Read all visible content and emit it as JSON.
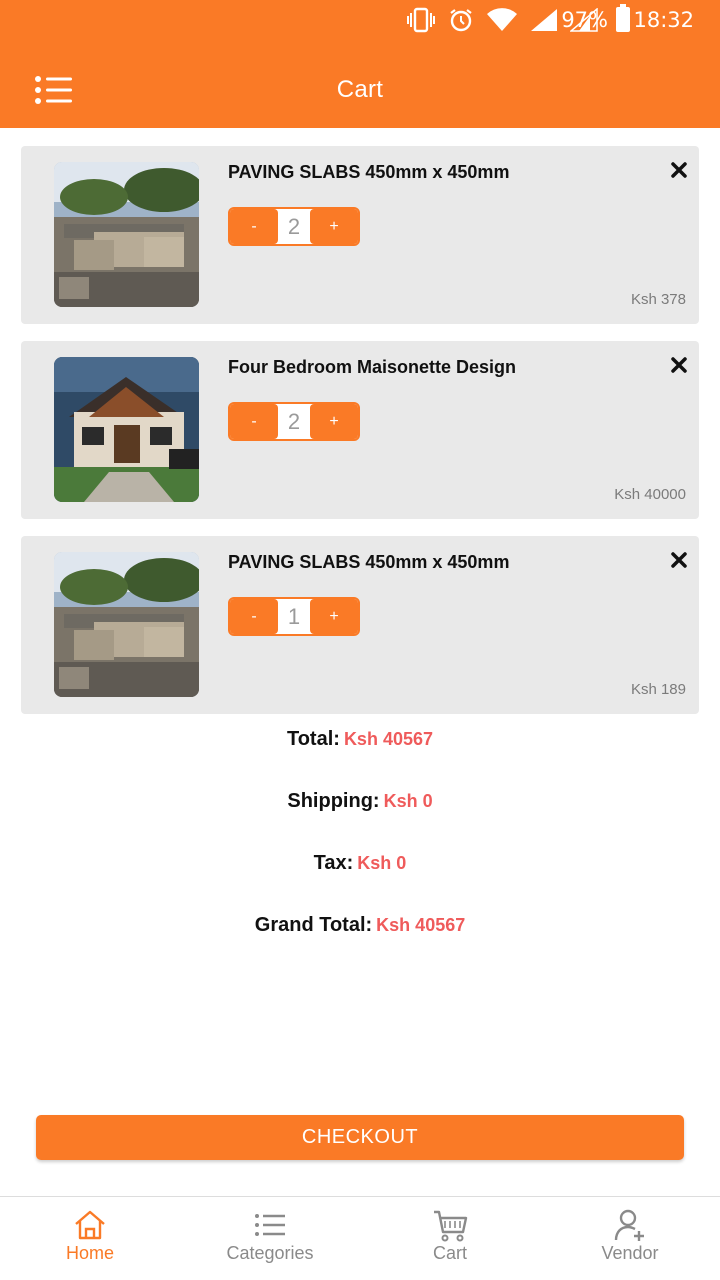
{
  "status_bar": {
    "battery": "97%",
    "time": "18:32"
  },
  "header": {
    "title": "Cart",
    "menu_icon": "menu-list-icon"
  },
  "colors": {
    "brand": "#fa7a26",
    "accent_value": "#ef5b5b",
    "card_bg": "#e9e9e9"
  },
  "cart": {
    "items": [
      {
        "name": "PAVING SLABS 450mm x 450mm",
        "quantity": "2",
        "price": "Ksh 378",
        "minus": "-",
        "plus": "+",
        "image": "paving-slabs-photo"
      },
      {
        "name": "Four Bedroom Maisonette Design",
        "quantity": "2",
        "price": "Ksh 40000",
        "minus": "-",
        "plus": "+",
        "image": "maisonette-house-photo"
      },
      {
        "name": "PAVING SLABS 450mm x 450mm",
        "quantity": "1",
        "price": "Ksh 189",
        "minus": "-",
        "plus": "+",
        "image": "paving-slabs-photo"
      }
    ]
  },
  "summary": {
    "total_label": "Total:",
    "total_value": "Ksh 40567",
    "shipping_label": "Shipping:",
    "shipping_value": "Ksh 0",
    "tax_label": "Tax:",
    "tax_value": "Ksh 0",
    "grand_total_label": "Grand Total:",
    "grand_total_value": "Ksh 40567"
  },
  "checkout_label": "CHECKOUT",
  "nav": {
    "items": [
      {
        "label": "Home",
        "icon": "home-icon",
        "active": true
      },
      {
        "label": "Categories",
        "icon": "list-icon",
        "active": false
      },
      {
        "label": "Cart",
        "icon": "cart-icon",
        "active": false
      },
      {
        "label": "Vendor",
        "icon": "add-user-icon",
        "active": false
      }
    ]
  }
}
